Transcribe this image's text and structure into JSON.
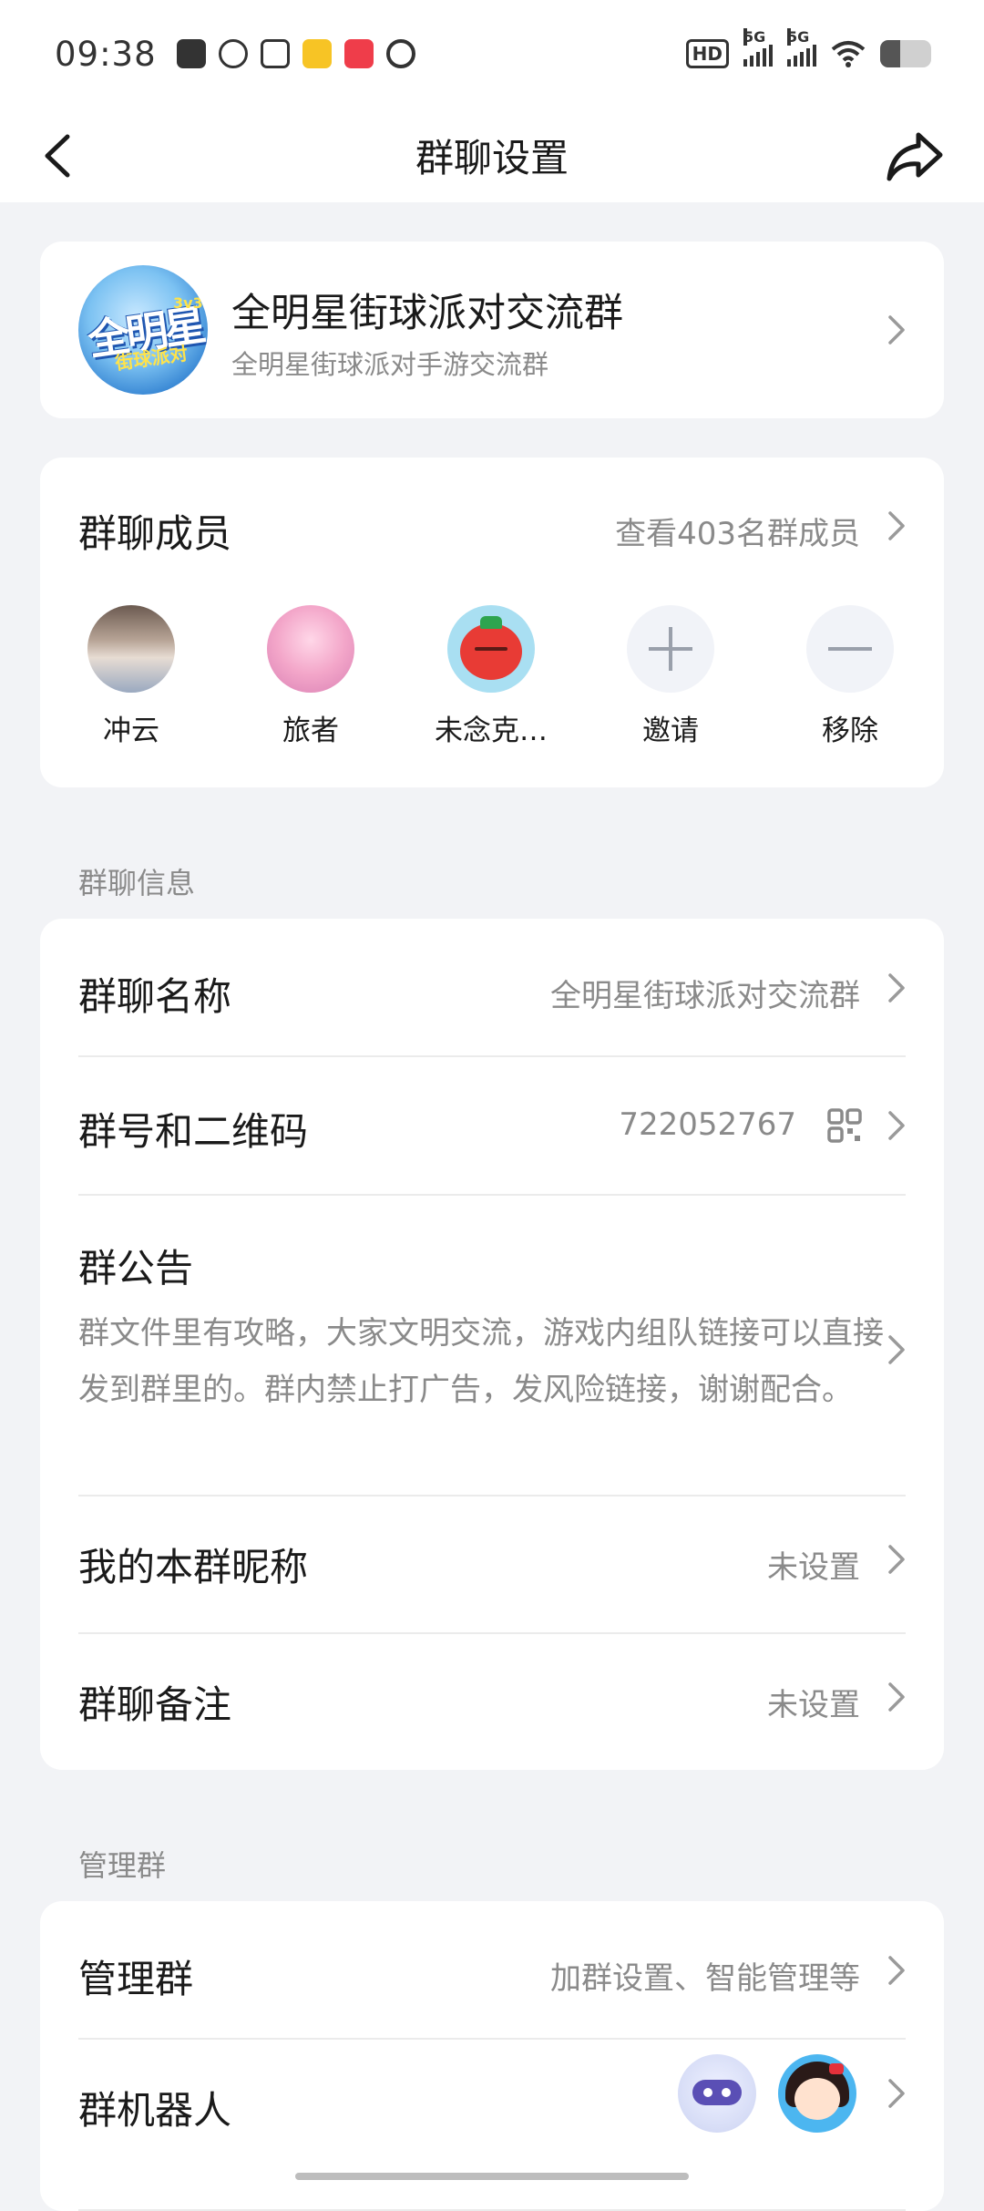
{
  "status_bar": {
    "time": "09:38",
    "hd_label": "HD",
    "signal1_label": "5G",
    "signal2_label": "5G",
    "battery_level": 0.4,
    "notification_icons": [
      "message-icon",
      "qq-icon",
      "news-icon",
      "meituan-icon",
      "xiaohongshu-icon",
      "browser-icon"
    ]
  },
  "nav": {
    "title": "群聊设置",
    "back_icon": "chevron-left-icon",
    "share_icon": "share-icon"
  },
  "group": {
    "name": "全明星街球派对交流群",
    "description": "全明星街球派对手游交流群",
    "avatar_text": "全明星",
    "avatar_sub": "街球派对",
    "avatar_mark": "3v3"
  },
  "members": {
    "title": "群聊成员",
    "view_all": "查看403名群成员",
    "list": [
      {
        "name": "冲云"
      },
      {
        "name": "旅者"
      },
      {
        "name": "未念克…"
      }
    ],
    "invite_label": "邀请",
    "remove_label": "移除"
  },
  "info_section": {
    "label": "群聊信息",
    "group_name_title": "群聊名称",
    "group_name_value": "全明星街球派对交流群",
    "group_id_title": "群号和二维码",
    "group_id_value": "722052767",
    "notice_title": "群公告",
    "notice_text": "群文件里有攻略，大家文明交流，游戏内组队链接可以直接发到群里的。群内禁止打广告，发风险链接，谢谢配合。",
    "nickname_title": "我的本群昵称",
    "nickname_value": "未设置",
    "remark_title": "群聊备注",
    "remark_value": "未设置"
  },
  "manage_section": {
    "label": "管理群",
    "manage_title": "管理群",
    "manage_value": "加群设置、智能管理等",
    "robot_title": "群机器人"
  }
}
